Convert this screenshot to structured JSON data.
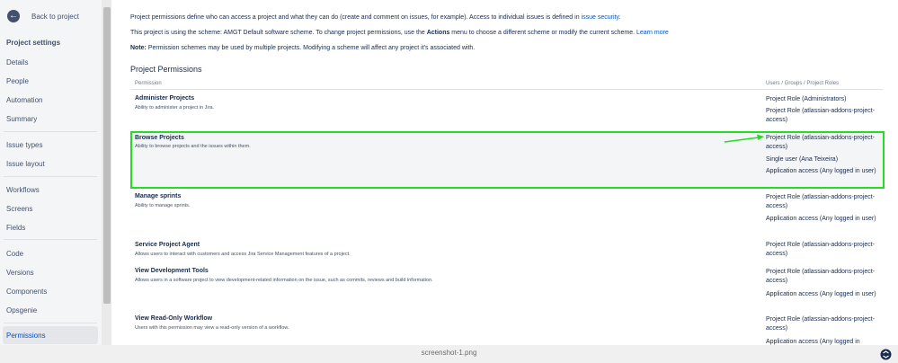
{
  "sidebar": {
    "back_label": "Back to project",
    "heading": "Project settings",
    "items": [
      "Details",
      "People",
      "Automation",
      "Summary",
      "Issue types",
      "Issue layout",
      "Workflows",
      "Screens",
      "Fields",
      "Code",
      "Versions",
      "Components",
      "Opsgenie"
    ],
    "active": "Permissions"
  },
  "intro": {
    "line1_text": "Project permissions define who can access a project and what they can do (create and comment on issues, for example). Access to individual issues is defined in ",
    "line1_link": "issue security",
    "line1_end": ".",
    "line2_text": "This project is using the scheme: AMGT Default software scheme. To change project permissions, use the ",
    "line2_bold": "Actions",
    "line2_mid": " menu to choose a different scheme or modify the current scheme. ",
    "line2_link": "Learn more",
    "line3_bold": "Note:",
    "line3_text": " Permission schemes may be used by multiple projects. Modifying a scheme will affect any project it's associated with."
  },
  "table": {
    "title": "Project Permissions",
    "col_permission": "Permission",
    "col_roles": "Users / Groups / Project Roles",
    "rows": [
      {
        "name": "Administer Projects",
        "desc": "Ability to administer a project in Jira.",
        "roles": [
          "Project Role (Administrators)",
          "Project Role (atlassian-addons-project-access)"
        ]
      },
      {
        "name": "Browse Projects",
        "desc": "Ability to browse projects and the issues within them.",
        "roles": [
          "Project Role (atlassian-addons-project-access)",
          "Single user (Ana Teixeira)",
          "Application access (Any logged in user)"
        ]
      },
      {
        "name": "Manage sprints",
        "desc": "Ability to manage sprints.",
        "roles": [
          "Project Role (atlassian-addons-project-access)",
          "Application access (Any logged in user)"
        ]
      },
      {
        "name": "Service Project Agent",
        "desc": "Allows users to interact with customers and access Jira Service Management features of a project.",
        "roles": [
          "Project Role (atlassian-addons-project-access)"
        ]
      },
      {
        "name": "View Development Tools",
        "desc": "Allows users in a software project to view development-related information on the issue, such as commits, reviews and build information.",
        "roles": [
          "Project Role (atlassian-addons-project-access)",
          "Application access (Any logged in user)"
        ]
      },
      {
        "name": "View Read-Only Workflow",
        "desc": "Users with this permission may view a read-only version of a workflow.",
        "roles": [
          "Project Role (atlassian-addons-project-access)",
          "Application access (Any logged in"
        ]
      }
    ]
  },
  "footer": {
    "caption": "screenshot-1.png"
  },
  "colors": {
    "highlight_border": "#22dd22",
    "arrow": "#22dd22",
    "link": "#0052cc"
  },
  "icons": {
    "back": "arrow-left-icon",
    "corner": "assistant-icon"
  }
}
